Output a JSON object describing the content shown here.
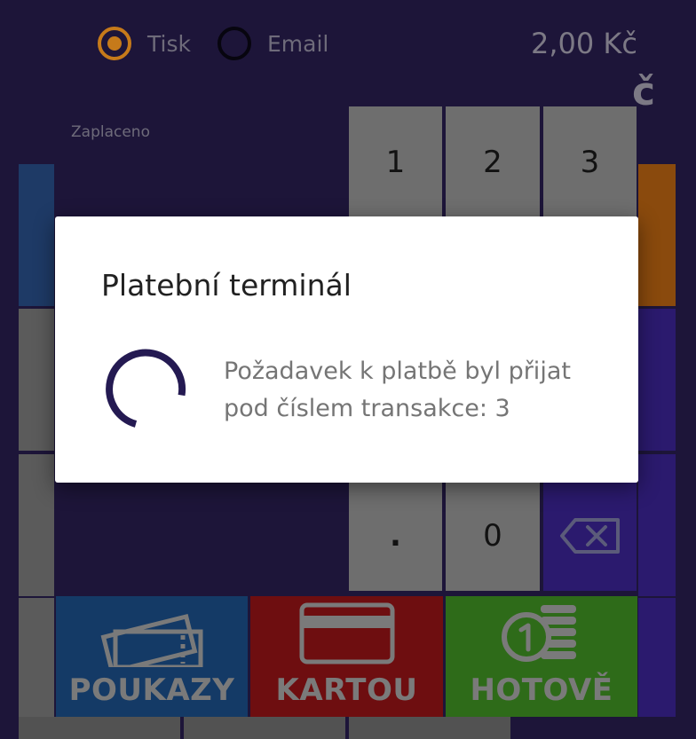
{
  "header": {
    "print_option": "Tisk",
    "email_option": "Email",
    "total": "2,00 Kč",
    "glyph": "č",
    "paid_label": "Zaplaceno"
  },
  "keypad": {
    "keys_top": [
      "1",
      "2",
      "3"
    ],
    "decimal": ".",
    "zero": "0"
  },
  "actions": {
    "vouchers": "POUKAZY",
    "card": "KARTOU",
    "cash": "HOTOVĚ"
  },
  "dialog": {
    "title": "Platební terminál",
    "message": "Požadavek k platbě byl přijat pod číslem transakce: 3"
  },
  "colors": {
    "accent_orange": "#c67a1a",
    "spinner": "#241a52"
  }
}
